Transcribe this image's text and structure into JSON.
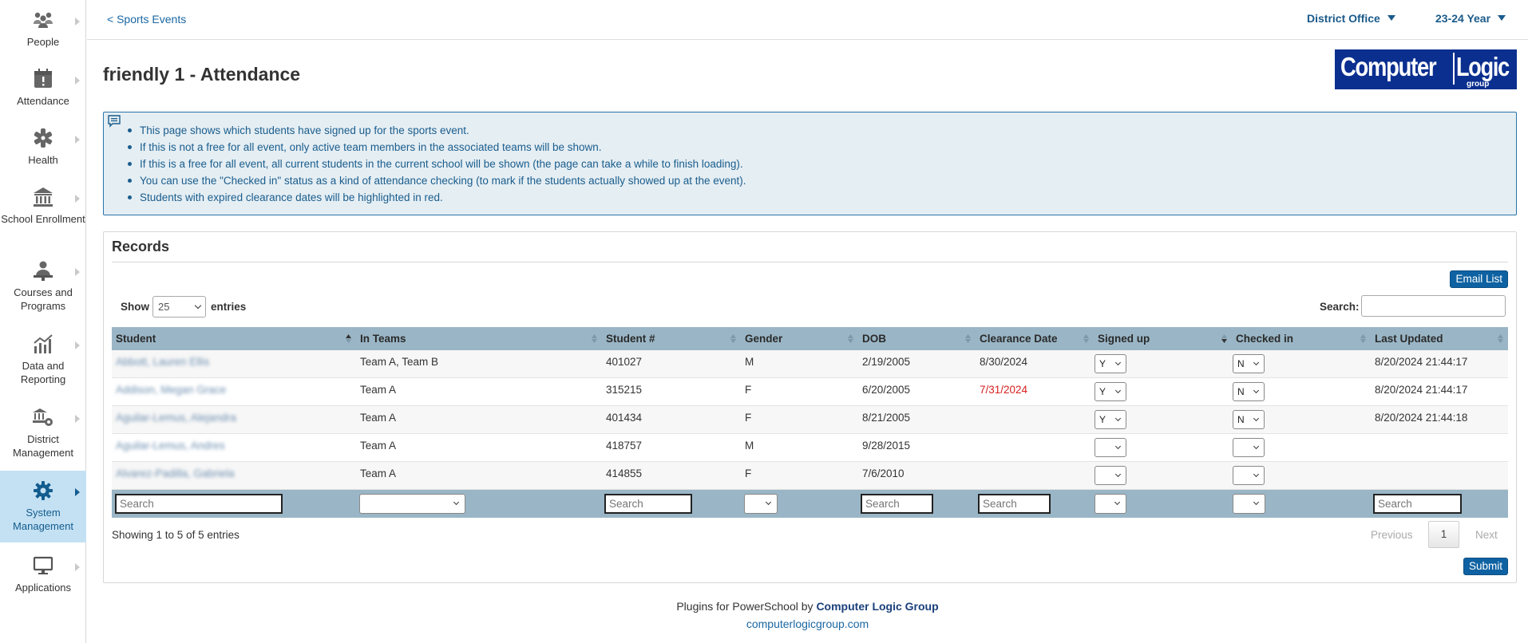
{
  "sidebar": {
    "items": [
      {
        "label": "People",
        "icon": "people-icon"
      },
      {
        "label": "Attendance",
        "icon": "attendance-icon"
      },
      {
        "label": "Health",
        "icon": "health-icon"
      },
      {
        "label": "School Enrollment",
        "icon": "school-icon"
      },
      {
        "label": "Courses and Programs",
        "icon": "teacher-icon"
      },
      {
        "label": "Data and Reporting",
        "icon": "chart-icon"
      },
      {
        "label": "District Management",
        "icon": "district-icon"
      },
      {
        "label": "System Management",
        "icon": "gear-icon"
      },
      {
        "label": "Applications",
        "icon": "monitor-icon"
      }
    ]
  },
  "topbar": {
    "back_link": "< Sports Events",
    "district_menu": "District Office",
    "year_menu": "23-24 Year"
  },
  "page": {
    "title": "friendly 1 - Attendance"
  },
  "logo": {
    "word1": "Computer",
    "word2": "Logic",
    "word3": "group"
  },
  "info": {
    "bullets": [
      "This page shows which students have signed up for the sports event.",
      "If this is not a free for all event, only active team members in the associated teams will be shown.",
      "If this is a free for all event, all current students in the current school will be shown (the page can take a while to finish loading).",
      "You can use the \"Checked in\" status as a kind of attendance checking (to mark if the students actually showed up at the event).",
      "Students with expired clearance dates will be highlighted in red."
    ]
  },
  "records": {
    "title": "Records",
    "email_button": "Email List",
    "show_label": "Show",
    "show_value": "25",
    "entries_label": "entries",
    "search_label": "Search:",
    "columns": [
      "Student",
      "In Teams",
      "Student #",
      "Gender",
      "DOB",
      "Clearance Date",
      "Signed up",
      "Checked in",
      "Last Updated"
    ],
    "rows": [
      {
        "student": "Abbott, Lauren Ellis",
        "teams": "Team A, Team B",
        "number": "401027",
        "gender": "M",
        "dob": "2/19/2005",
        "clearance": "8/30/2024",
        "signed": "Y",
        "checked": "N",
        "updated": "8/20/2024 21:44:17"
      },
      {
        "student": "Addison, Megan Grace",
        "teams": "Team A",
        "number": "315215",
        "gender": "F",
        "dob": "6/20/2005",
        "clearance": "7/31/2024",
        "signed": "Y",
        "checked": "N",
        "updated": "8/20/2024 21:44:17"
      },
      {
        "student": "Aguilar-Lemus, Alejandra",
        "teams": "Team A",
        "number": "401434",
        "gender": "F",
        "dob": "8/21/2005",
        "clearance": "",
        "signed": "Y",
        "checked": "N",
        "updated": "8/20/2024 21:44:18"
      },
      {
        "student": "Aguilar-Lemus, Andres",
        "teams": "Team A",
        "number": "418757",
        "gender": "M",
        "dob": "9/28/2015",
        "clearance": "",
        "signed": "",
        "checked": "",
        "updated": ""
      },
      {
        "student": "Alvarez-Padilla, Gabriela",
        "teams": "Team A",
        "number": "414855",
        "gender": "F",
        "dob": "7/6/2010",
        "clearance": "",
        "signed": "",
        "checked": "",
        "updated": ""
      }
    ],
    "filter_placeholder": "Search",
    "showing_text": "Showing 1 to 5 of 5 entries",
    "pager": {
      "prev": "Previous",
      "page": "1",
      "next": "Next"
    },
    "submit_button": "Submit"
  },
  "footer": {
    "line1_prefix": "Plugins for PowerSchool by ",
    "line1_brand": "Computer Logic Group",
    "line2": "computerlogicgroup.com"
  },
  "colors": {
    "header_bg": "#9ab6c6",
    "info_bg": "#e5eef3",
    "accent": "#0f62a2",
    "expired": "#d71f1f",
    "active_nav": "#c4e1f3"
  }
}
